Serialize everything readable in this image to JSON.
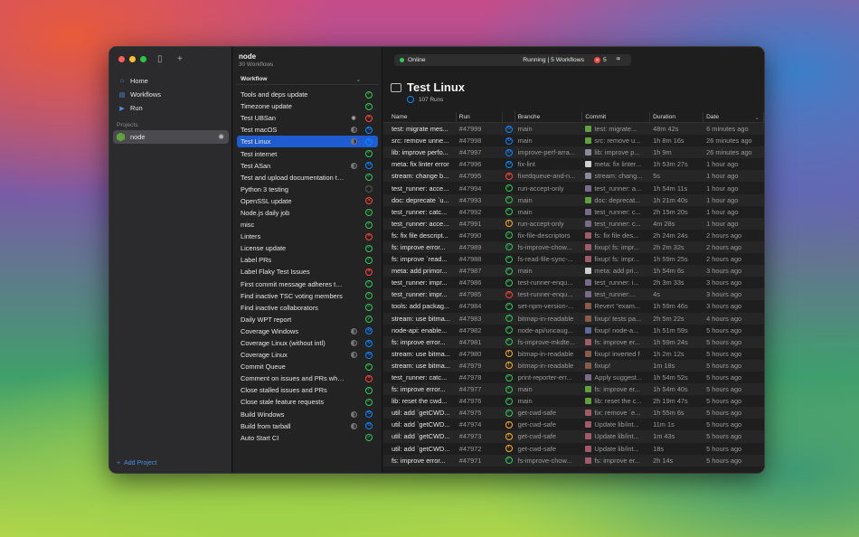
{
  "sidebar": {
    "nav": [
      {
        "label": "Home",
        "icon": "home-icon"
      },
      {
        "label": "Workflows",
        "icon": "workflows-icon"
      },
      {
        "label": "Run",
        "icon": "run-icon"
      }
    ],
    "section_label": "Projects",
    "project": "node",
    "add_project": "Add Project"
  },
  "column": {
    "title": "node",
    "subtitle": "30 Workflows",
    "header": "Workflow",
    "workflows": [
      {
        "name": "Tools and deps update",
        "status": "ok",
        "ind": ""
      },
      {
        "name": "Timezone update",
        "status": "ok",
        "ind": ""
      },
      {
        "name": "Test UBSan",
        "status": "err",
        "ind": "spin"
      },
      {
        "name": "Test macOS",
        "status": "run",
        "ind": "half"
      },
      {
        "name": "Test Linux",
        "status": "run",
        "ind": "half",
        "selected": true
      },
      {
        "name": "Test internet",
        "status": "ok",
        "ind": ""
      },
      {
        "name": "Test ASan",
        "status": "run",
        "ind": "half"
      },
      {
        "name": "Test and upload documentation to a...",
        "status": "ok",
        "ind": ""
      },
      {
        "name": "Python 3 testing",
        "status": "empty",
        "ind": ""
      },
      {
        "name": "OpenSSL update",
        "status": "err",
        "ind": ""
      },
      {
        "name": "Node.js daily job",
        "status": "ok",
        "ind": ""
      },
      {
        "name": "misc",
        "status": "ok",
        "ind": ""
      },
      {
        "name": "Linters",
        "status": "err",
        "ind": ""
      },
      {
        "name": "License update",
        "status": "ok",
        "ind": ""
      },
      {
        "name": "Label PRs",
        "status": "ok",
        "ind": ""
      },
      {
        "name": "Label Flaky Test Issues",
        "status": "err",
        "ind": ""
      },
      {
        "name": "First commit message adheres to g...",
        "status": "ok",
        "ind": ""
      },
      {
        "name": "Find inactive TSC voting members",
        "status": "ok",
        "ind": ""
      },
      {
        "name": "Find inactive collaborators",
        "status": "ok",
        "ind": ""
      },
      {
        "name": "Daily WPT report",
        "status": "ok",
        "ind": ""
      },
      {
        "name": "Coverage Windows",
        "status": "run",
        "ind": "half"
      },
      {
        "name": "Coverage Linux (without intl)",
        "status": "run",
        "ind": "half"
      },
      {
        "name": "Coverage Linux",
        "status": "run",
        "ind": "half"
      },
      {
        "name": "Commit Queue",
        "status": "ok",
        "ind": ""
      },
      {
        "name": "Comment on issues and PRs when l...",
        "status": "err",
        "ind": ""
      },
      {
        "name": "Close stalled issues and PRs",
        "status": "ok",
        "ind": ""
      },
      {
        "name": "Close stale feature requests",
        "status": "ok",
        "ind": ""
      },
      {
        "name": "Build Windows",
        "status": "run",
        "ind": "half"
      },
      {
        "name": "Build from tarball",
        "status": "run",
        "ind": "half"
      },
      {
        "name": "Auto Start CI",
        "status": "ok",
        "ind": ""
      }
    ]
  },
  "topbar": {
    "status": "Online",
    "running": "Running | 5 Workflows",
    "errors": "5"
  },
  "main": {
    "title": "Test Linux",
    "runs": "107 Runs"
  },
  "table": {
    "headers": [
      "Name",
      "Run",
      "",
      "Branche",
      "Commit",
      "Duration",
      "Date"
    ],
    "rows": [
      [
        "test: migrate mes...",
        "#47999",
        "run",
        "main",
        "#5ea13e",
        "test: migrate...",
        "48m 42s",
        "6 minutes ago"
      ],
      [
        "src: remove unne...",
        "#47998",
        "run",
        "main",
        "#5ea13e",
        "src: remove u...",
        "1h 8m 16s",
        "26 minutes ago"
      ],
      [
        "lib: improve perfo...",
        "#47997",
        "run",
        "improve-perf-arra...",
        "#8a8a9a",
        "lib: improve p...",
        "1h 9m",
        "26 minutes ago"
      ],
      [
        "meta: fix linter error",
        "#47996",
        "run",
        "fix-lint",
        "#cfcfcf",
        "meta: fix linter...",
        "1h 53m 27s",
        "1 hour ago"
      ],
      [
        "stream: change b...",
        "#47995",
        "err",
        "fixedqueue-and-n...",
        "#8a8a9a",
        "stream: chang...",
        "5s",
        "1 hour ago"
      ],
      [
        "test_runner: acce...",
        "#47994",
        "ok",
        "run-accept-only",
        "#7a6a8a",
        "test_runner: a...",
        "1h 54m 11s",
        "1 hour ago"
      ],
      [
        "doc: deprecate `u...",
        "#47993",
        "ok",
        "main",
        "#5ea13e",
        "doc: deprecat...",
        "1h 21m 40s",
        "1 hour ago"
      ],
      [
        "test_runner: catc...",
        "#47992",
        "ok",
        "main",
        "#7a6a8a",
        "test_runner: c...",
        "2h 15m 20s",
        "1 hour ago"
      ],
      [
        "test_runner: acce...",
        "#47991",
        "warn",
        "run-accept-only",
        "#7a6a8a",
        "test_runner: c...",
        "4m 28s",
        "1 hour ago"
      ],
      [
        "fs: fix file descript...",
        "#47990",
        "ok",
        "fix-file-descriptors",
        "#a05a6a",
        "fs: fix file des...",
        "2h 24m 24s",
        "2 hours ago"
      ],
      [
        "fs: improve error...",
        "#47989",
        "ok",
        "fs-improve-chow...",
        "#a05a6a",
        "fixup! fs: impr...",
        "2h 2m 32s",
        "2 hours ago"
      ],
      [
        "fs: improve `read...",
        "#47988",
        "ok",
        "fs-read-file-sync-...",
        "#a05a6a",
        "fixup! fs: impr...",
        "1h 59m 25s",
        "2 hours ago"
      ],
      [
        "meta: add primor...",
        "#47987",
        "ok",
        "main",
        "#cfcfcf",
        "meta: add pri...",
        "1h 54m 6s",
        "3 hours ago"
      ],
      [
        "test_runner: impr...",
        "#47986",
        "ok",
        "test-runner-enqu...",
        "#7a6a8a",
        "test_runner: i...",
        "2h 3m 33s",
        "3 hours ago"
      ],
      [
        "test_runner: impr...",
        "#47985",
        "err",
        "test-runner-enqu...",
        "#7a6a8a",
        "test_runner:...",
        "4s",
        "3 hours ago"
      ],
      [
        "tools: add packag...",
        "#47984",
        "ok",
        "set-npm-version-...",
        "#8a5a4a",
        "Revert \"exam...",
        "1h 59m 46s",
        "3 hours ago"
      ],
      [
        "stream: use bitma...",
        "#47983",
        "ok",
        "bitmap-in-readable",
        "#8a5a4a",
        "fixup! tests pa...",
        "2h 5m 22s",
        "4 hours ago"
      ],
      [
        "node-api: enable...",
        "#47982",
        "ok",
        "node-api/uncaug...",
        "#5a6a9a",
        "fixup! node-a...",
        "1h 51m 59s",
        "5 hours ago"
      ],
      [
        "fs: improve error...",
        "#47981",
        "ok",
        "fs-improve-mkdte...",
        "#a05a6a",
        "fs: improve er...",
        "1h 59m 24s",
        "5 hours ago"
      ],
      [
        "stream: use bitma...",
        "#47980",
        "warn",
        "bitmap-in-readable",
        "#8a5a4a",
        "fixup! inverted f",
        "1h 2m 12s",
        "5 hours ago"
      ],
      [
        "stream: use bitma...",
        "#47979",
        "warn",
        "bitmap-in-readable",
        "#8a5a4a",
        "fixup!",
        "1m 18s",
        "5 hours ago"
      ],
      [
        "test_runner: catc...",
        "#47978",
        "ok",
        "print-reporter-err...",
        "#7a6a8a",
        "Apply suggest...",
        "1h 54m 52s",
        "5 hours ago"
      ],
      [
        "fs: improve error...",
        "#47977",
        "ok",
        "main",
        "#5ea13e",
        "fs: improve er...",
        "1h 54m 40s",
        "5 hours ago"
      ],
      [
        "lib: reset the cwd...",
        "#47976",
        "ok",
        "main",
        "#5ea13e",
        "lib: reset the c...",
        "2h 19m 47s",
        "5 hours ago"
      ],
      [
        "util: add `getCWD...",
        "#47975",
        "ok",
        "get-cwd-safe",
        "#a05a6a",
        "fix: remove `e...",
        "1h 55m 6s",
        "5 hours ago"
      ],
      [
        "util: add `getCWD...",
        "#47974",
        "warn",
        "get-cwd-safe",
        "#a05a6a",
        "Update lib/int...",
        "11m 1s",
        "5 hours ago"
      ],
      [
        "util: add `getCWD...",
        "#47973",
        "warn",
        "get-cwd-safe",
        "#a05a6a",
        "Update lib/int...",
        "1m 43s",
        "5 hours ago"
      ],
      [
        "util: add `getCWD...",
        "#47972",
        "warn",
        "get-cwd-safe",
        "#a05a6a",
        "Update lib/int...",
        "18s",
        "5 hours ago"
      ],
      [
        "fs: improve error...",
        "#47971",
        "ok",
        "fs-improve-chow...",
        "#a05a6a",
        "fs: improve er...",
        "2h 14s",
        "5 hours ago"
      ]
    ]
  }
}
